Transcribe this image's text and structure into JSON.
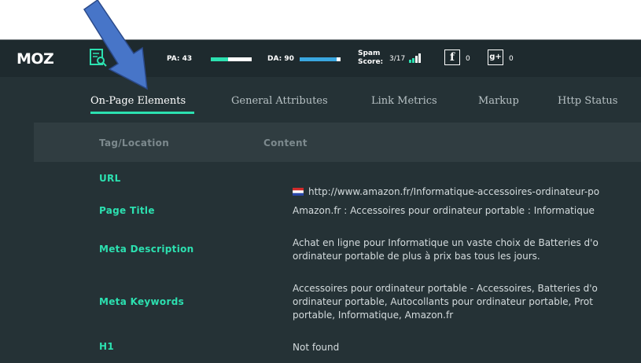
{
  "toolbar": {
    "logo": "MOZ",
    "pa_label": "PA: 43",
    "pa_value": 43,
    "da_label": "DA: 90",
    "da_value": 90,
    "spam_label": "Spam\nScore:",
    "spam_value": "3/17",
    "facebook_icon_text": "f",
    "facebook_count": "0",
    "gplus_icon_text": "g+",
    "gplus_count": "0",
    "accent_color": "#2ce0b0",
    "da_color": "#3aa7e0"
  },
  "tabs": [
    {
      "label": "On-Page Elements",
      "active": true
    },
    {
      "label": "General Attributes",
      "active": false
    },
    {
      "label": "Link Metrics",
      "active": false
    },
    {
      "label": "Markup",
      "active": false
    },
    {
      "label": "Http Status",
      "active": false
    }
  ],
  "table": {
    "headers": [
      "Tag/Location",
      "Content"
    ],
    "rows": [
      {
        "label": "URL",
        "content": "http://www.amazon.fr/Informatique-accessoires-ordinateur-po"
      },
      {
        "label": "Page Title",
        "content": "Amazon.fr : Accessoires pour ordinateur portable : Informatique"
      },
      {
        "label": "Meta Description",
        "content": "Achat en ligne pour Informatique un vaste choix de Batteries d'o\nordinateur portable de plus à prix bas tous les jours."
      },
      {
        "label": "Meta Keywords",
        "content": "Accessoires pour ordinateur portable - Accessoires, Batteries d'o\nordinateur portable, Autocollants pour ordinateur portable, Prot\nportable, Informatique, Amazon.fr"
      },
      {
        "label": "H1",
        "content": "Not found"
      }
    ]
  }
}
